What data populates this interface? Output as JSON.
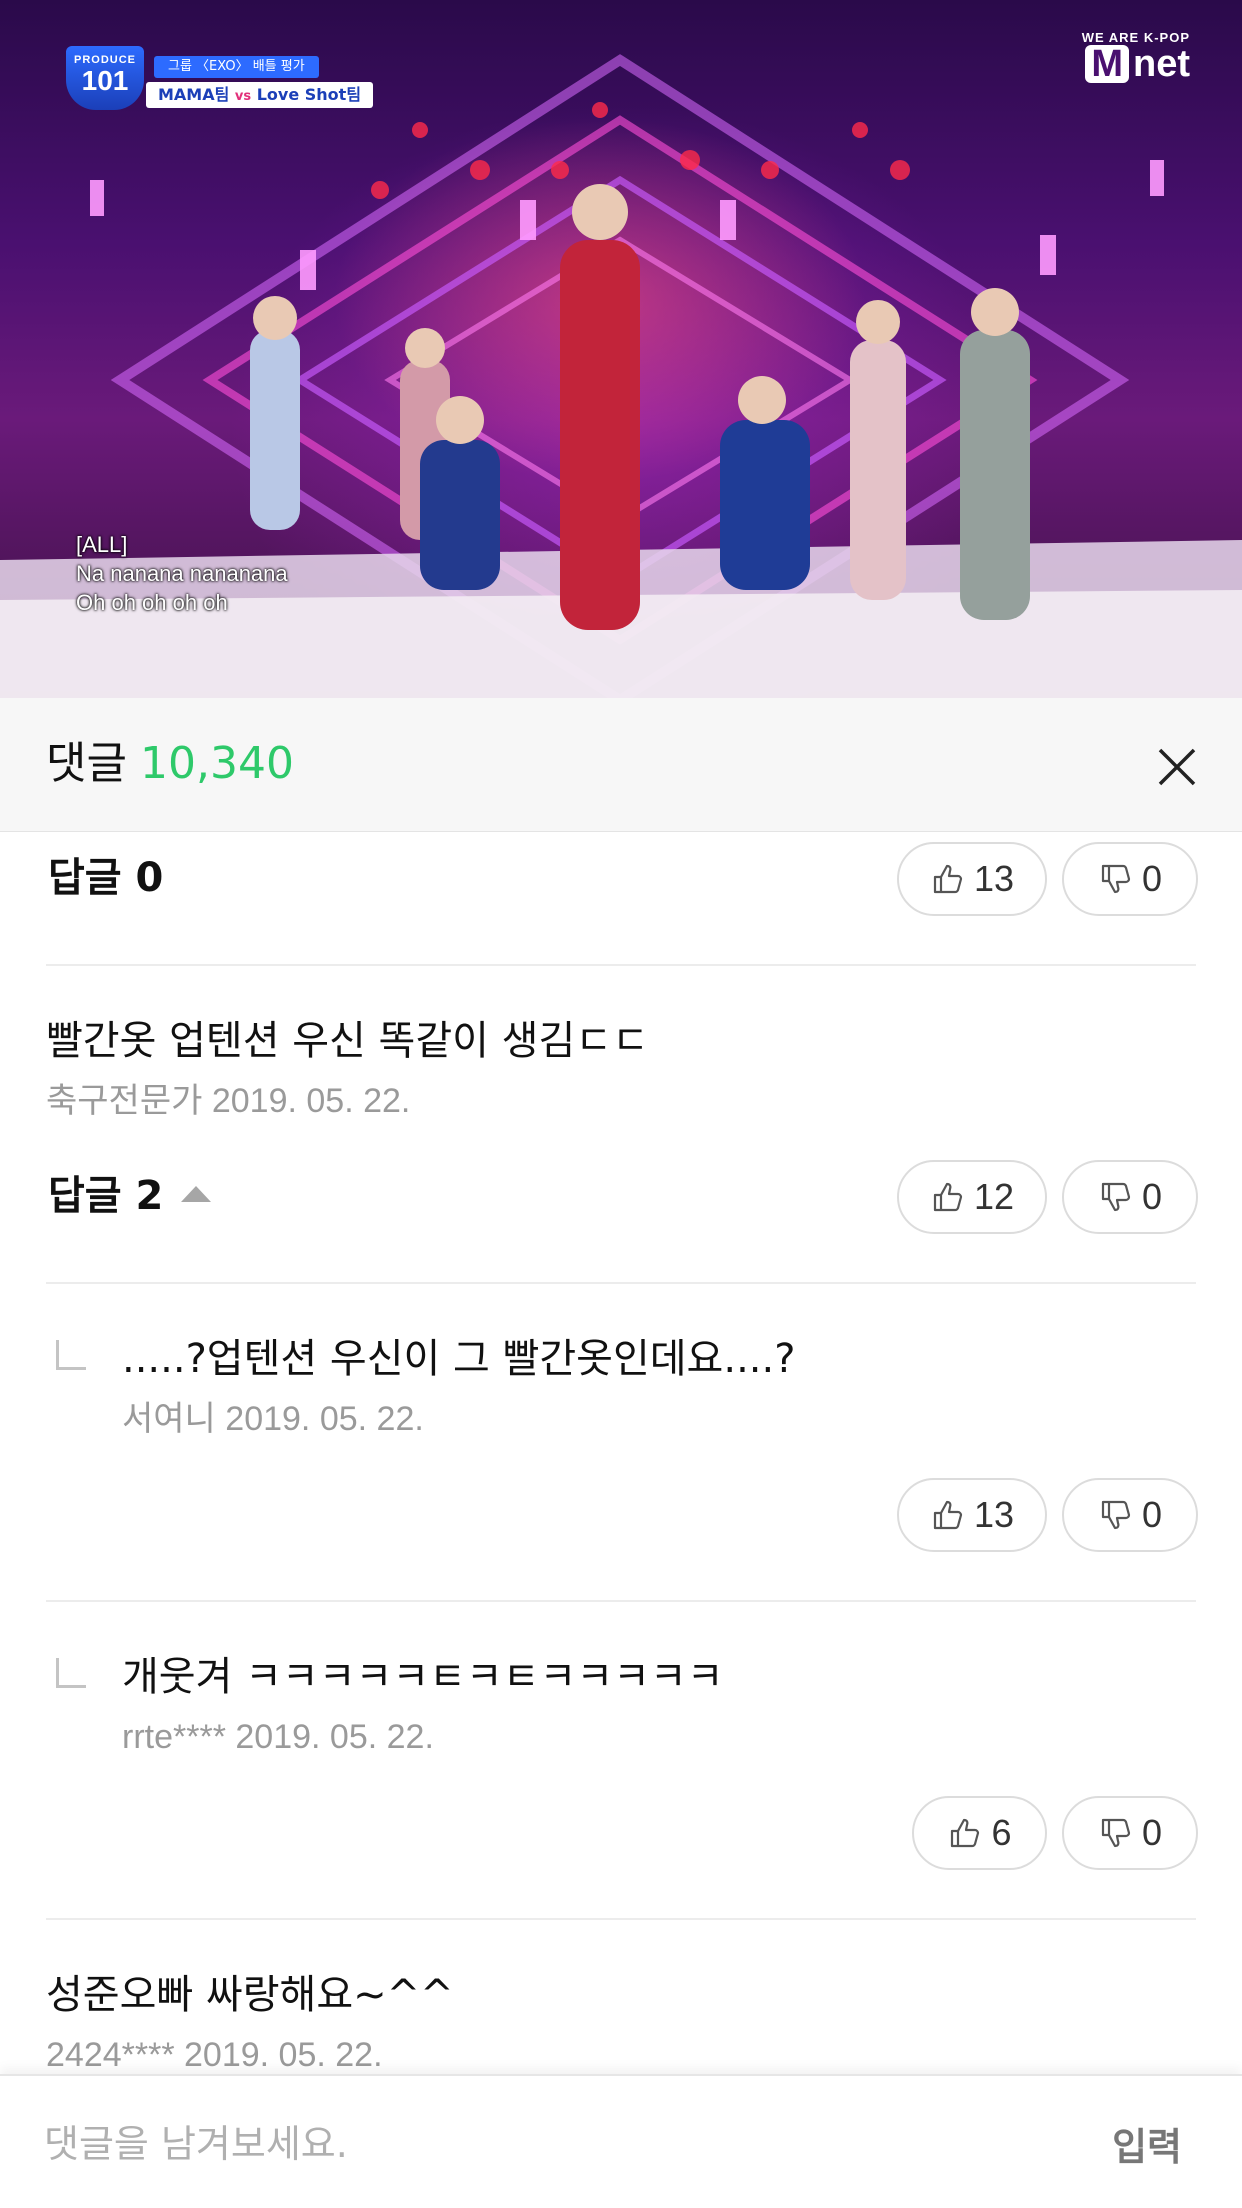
{
  "video": {
    "badge_line1": "그룹 〈EXO〉 배틀 평가",
    "badge_team1": "MAMA팀",
    "badge_vs": "vs",
    "badge_team2": "Love Shot팀",
    "logo_top": "PRODUCE",
    "logo_num": "101",
    "broadcaster_tag": "WE ARE K-POP",
    "broadcaster_m": "M",
    "broadcaster_net": "net",
    "subtitle_lines": [
      "[ALL]",
      "Na nanana nananana",
      "Oh oh oh oh oh"
    ]
  },
  "comments_header": {
    "title": "댓글",
    "count": "10,340",
    "close_icon": "close-icon"
  },
  "comments": {
    "c0": {
      "reply_label": "답글 0",
      "likes": "13",
      "dislikes": "0"
    },
    "c1": {
      "text": "빨간옷 업텐션 우신 똑같이 생김ㄷㄷ",
      "author": "축구전문가",
      "date": "2019. 05. 22.",
      "reply_label": "답글 2",
      "likes": "12",
      "dislikes": "0"
    },
    "r1": {
      "text": ".....?업텐션 우신이 그 빨간옷인데요....?",
      "author": "서여니",
      "date": "2019. 05. 22.",
      "likes": "13",
      "dislikes": "0"
    },
    "r2": {
      "text": "개웃겨 ㅋㅋㅋㅋㅋㅌㅋㅌㅋㅋㅋㅋㅋ",
      "author": "rrte****",
      "date": "2019. 05. 22.",
      "likes": "6",
      "dislikes": "0"
    },
    "c2": {
      "text": "성준오빠  싸랑해요~^^",
      "author": "2424****",
      "date": "2019. 05. 22."
    }
  },
  "input": {
    "placeholder": "댓글을 남겨보세요.",
    "submit_label": "입력"
  },
  "colors": {
    "accent_count": "#2ec96a",
    "meta_gray": "#9a9a9a"
  }
}
